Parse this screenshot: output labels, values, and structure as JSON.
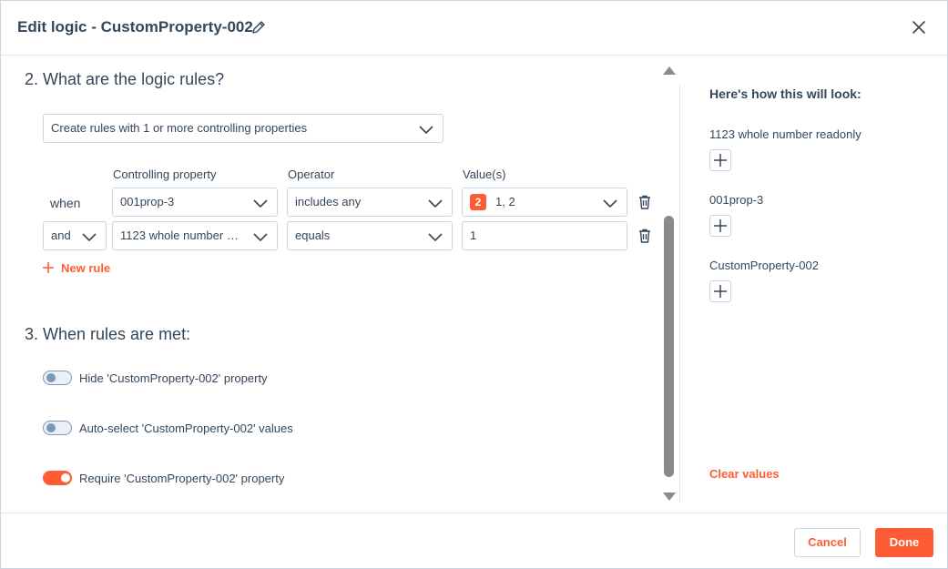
{
  "dialog": {
    "title": "Edit logic - CustomProperty-002",
    "edit_icon": "pencil-icon",
    "close_icon": "close-icon"
  },
  "section2": {
    "heading": "2. What are the logic rules?",
    "rule_mode_select": "Create rules with 1 or more controlling properties",
    "columns": {
      "controlling_property": "Controlling property",
      "operator": "Operator",
      "values": "Value(s)"
    },
    "rows": [
      {
        "connector": "when",
        "property": "001prop-3",
        "operator": "includes any",
        "value_count": "2",
        "value": "1, 2"
      },
      {
        "connector": "and",
        "property": "1123 whole number readonly",
        "operator": "equals",
        "value": "1"
      }
    ],
    "new_rule_label": "New rule"
  },
  "section3": {
    "heading": "3. When rules are met:",
    "toggles": [
      {
        "label": "Hide 'CustomProperty-002' property",
        "on": false
      },
      {
        "label": "Auto-select 'CustomProperty-002' values",
        "on": false
      },
      {
        "label": "Require 'CustomProperty-002' property",
        "on": true
      }
    ]
  },
  "preview": {
    "title": "Here's how this will look:",
    "fields": [
      {
        "label": "1123 whole number readonly"
      },
      {
        "label": "001prop-3"
      },
      {
        "label": "CustomProperty-002"
      }
    ],
    "clear_label": "Clear values"
  },
  "footer": {
    "cancel_label": "Cancel",
    "done_label": "Done"
  },
  "colors": {
    "accent": "#ff5c35",
    "text": "#33475b",
    "border": "#cbd6e2"
  }
}
